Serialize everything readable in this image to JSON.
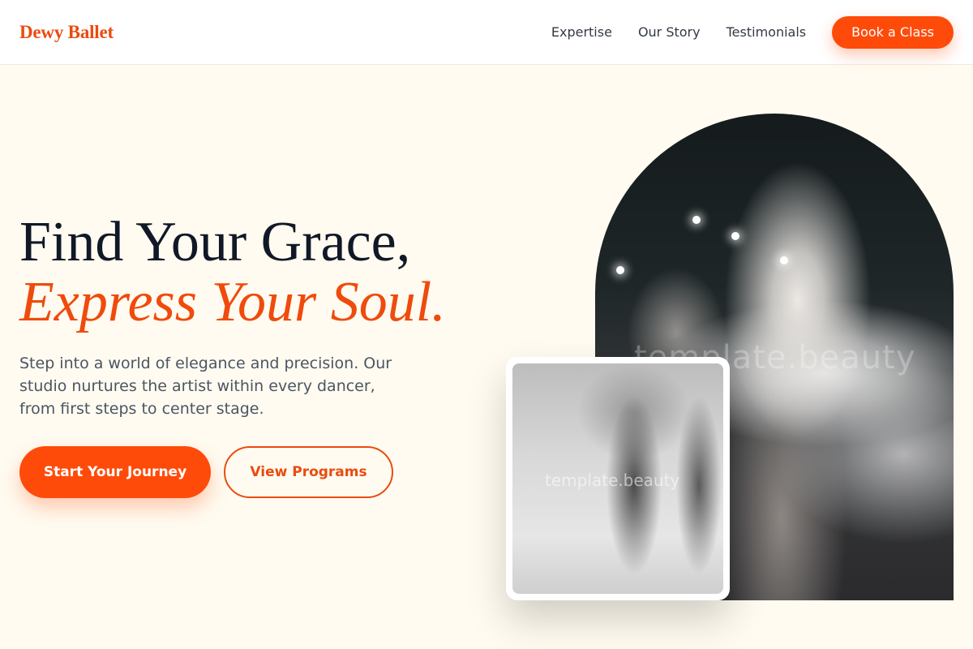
{
  "brand": {
    "name": "Dewy Ballet",
    "accent": "#ff4b0a"
  },
  "nav": {
    "links": [
      "Expertise",
      "Our Story",
      "Testimonials"
    ],
    "cta_label": "Book a Class"
  },
  "hero": {
    "title_line1": "Find Your Grace,",
    "title_line2": "Express Your Soul.",
    "description": "Step into a world of elegance and precision. Our studio nurtures the artist within every dancer, from first steps to center stage.",
    "primary_button": "Start Your Journey",
    "secondary_button": "View Programs"
  },
  "images": {
    "main_photo": {
      "alt": "Ballet dancers in white tutus on stage",
      "watermark": "template.beauty"
    },
    "inset_photo": {
      "alt": "Close-up of ballet pointe shoes",
      "watermark": "template.beauty"
    }
  }
}
